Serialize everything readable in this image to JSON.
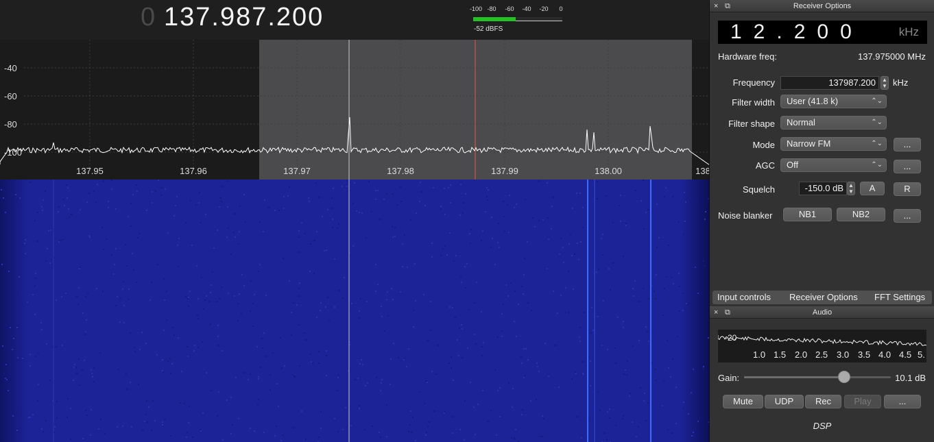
{
  "freq_display": {
    "lead": "0",
    "value": "137.987.200"
  },
  "meter": {
    "ticks": [
      "-100",
      "-80",
      "-60",
      "-40",
      "-20",
      "0"
    ],
    "level_fraction": 0.48,
    "label": "-52 dBFS",
    "bar_color": "#22c322"
  },
  "spectrum": {
    "y_labels": [
      "-40",
      "-60",
      "-80",
      "-100"
    ],
    "x_labels": [
      "137.95",
      "137.96",
      "137.97",
      "137.98",
      "137.99",
      "138.00",
      "138"
    ],
    "bg_color": "#1b1b1b",
    "passband_color": "#4b4b4d",
    "center_line_color": "#e0574b",
    "trace_color": "#ffffff"
  },
  "waterfall": {
    "bg_color": "#1c2396",
    "line_color": "#3e6bff"
  },
  "receiver_options": {
    "title": "Receiver Options",
    "close_icon": "×",
    "float_icon": "⧉",
    "lcd_value": "12.200",
    "lcd_unit": "kHz",
    "hw_freq_label": "Hardware freq:",
    "hw_freq_value": "137.975000 MHz",
    "frequency_label": "Frequency",
    "frequency_value": "137987.200",
    "frequency_unit": "kHz",
    "filter_width_label": "Filter width",
    "filter_width_value": "User (41.8 k)",
    "filter_shape_label": "Filter shape",
    "filter_shape_value": "Normal",
    "mode_label": "Mode",
    "mode_value": "Narrow FM",
    "agc_label": "AGC",
    "agc_value": "Off",
    "squelch_label": "Squelch",
    "squelch_value": "-150.0 dB",
    "squelch_auto": "A",
    "squelch_reset": "R",
    "noise_blanker_label": "Noise blanker",
    "nb1": "NB1",
    "nb2": "NB2",
    "more": "..."
  },
  "tabs": [
    "Input controls",
    "Receiver Options",
    "FFT Settings"
  ],
  "audio": {
    "title": "Audio",
    "fft_db_label": "-20",
    "fft_x_labels": [
      "1.0",
      "1.5",
      "2.0",
      "2.5",
      "3.0",
      "3.5",
      "4.0",
      "4.5",
      "5."
    ],
    "gain_label": "Gain:",
    "gain_value": "10.1 dB",
    "gain_fraction": 0.68,
    "buttons": {
      "mute": "Mute",
      "udp": "UDP",
      "rec": "Rec",
      "play": "Play",
      "more": "..."
    },
    "dsp_label": "DSP"
  }
}
